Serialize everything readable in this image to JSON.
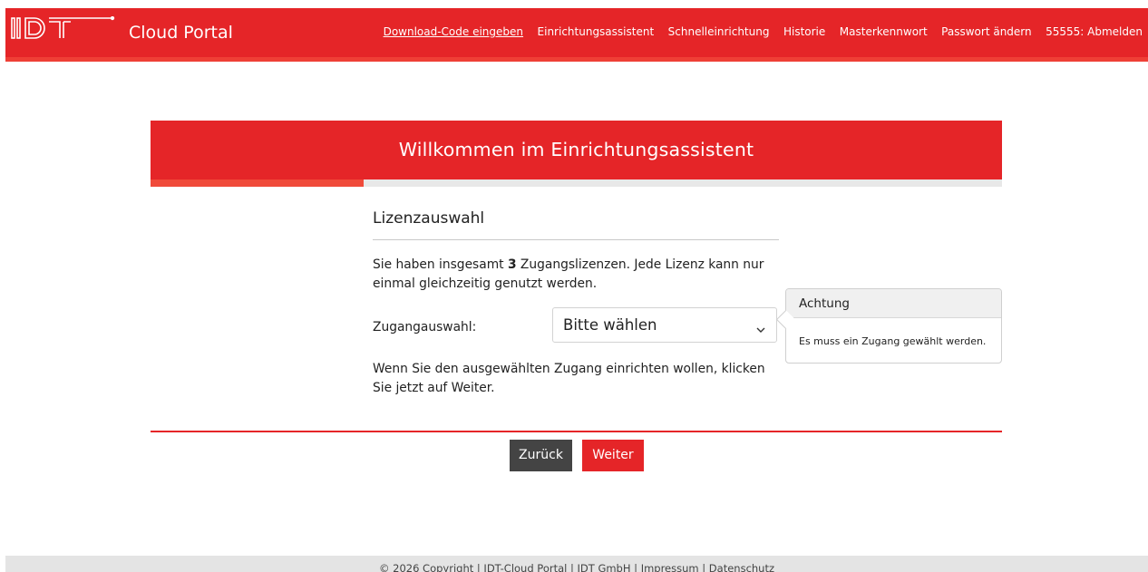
{
  "header": {
    "brand": "Cloud Portal",
    "logo_text": "IDT",
    "nav": [
      {
        "label": "Download-Code eingeben",
        "active": true
      },
      {
        "label": "Einrichtungsassistent",
        "active": false
      },
      {
        "label": "Schnelleinrichtung",
        "active": false
      },
      {
        "label": "Historie",
        "active": false
      },
      {
        "label": "Masterkennwort",
        "active": false
      },
      {
        "label": "Passwort ändern",
        "active": false
      },
      {
        "label": "55555: Abmelden",
        "active": false
      }
    ],
    "color": "#e52528"
  },
  "wizard": {
    "title": "Willkommen im Einrichtungsassistent",
    "progress_fraction": 0.25,
    "section_title": "Lizenzauswahl",
    "intro_prefix": "Sie haben insgesamt ",
    "license_count": "3",
    "intro_suffix": " Zugangslizenzen. Jede Lizenz kann nur einmal gleichzeitig genutzt werden.",
    "select_label": "Zugangauswahl:",
    "select_value": "Bitte wählen",
    "outro": "Wenn Sie den ausgewählten Zugang einrichten wollen, klicken Sie jetzt auf Weiter.",
    "buttons": {
      "back": "Zurück",
      "next": "Weiter"
    }
  },
  "popover": {
    "title": "Achtung",
    "message": "Es muss ein Zugang gewählt werden."
  },
  "footer": {
    "text": "© 2026 Copyright | IDT-Cloud Portal | IDT GmbH | Impressum | Datenschutz"
  }
}
